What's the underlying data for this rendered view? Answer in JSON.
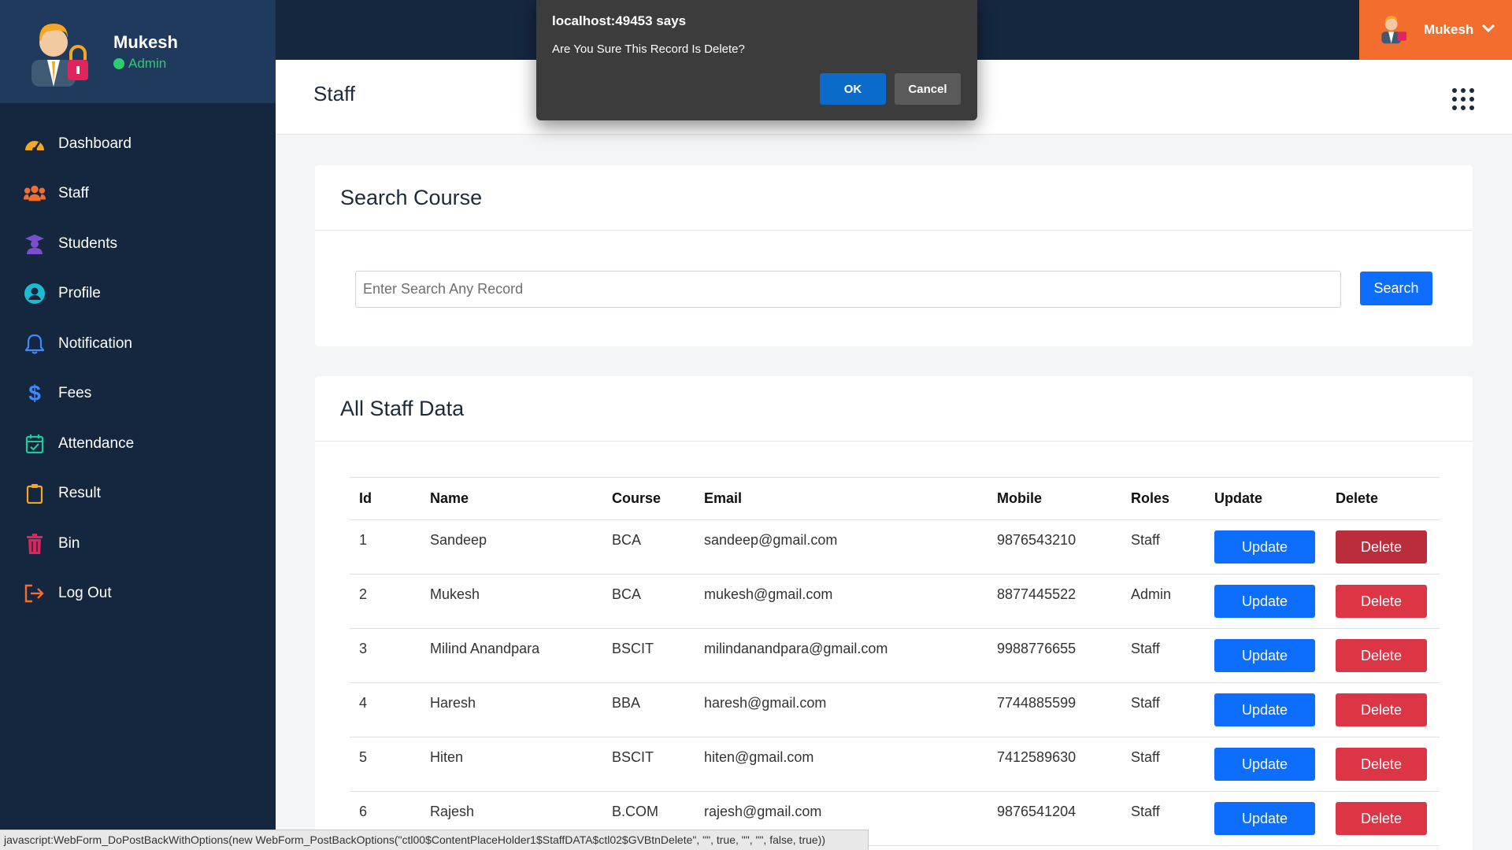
{
  "sidebar": {
    "user_name": "Mukesh",
    "user_role": "Admin",
    "items": [
      {
        "label": "Dashboard",
        "icon": "dashboard-icon",
        "color": "#f5a623"
      },
      {
        "label": "Staff",
        "icon": "users-icon",
        "color": "#f26d2e"
      },
      {
        "label": "Students",
        "icon": "graduate-icon",
        "color": "#7b4fc9"
      },
      {
        "label": "Profile",
        "icon": "user-circle-icon",
        "color": "#1abcd1"
      },
      {
        "label": "Notification",
        "icon": "bell-icon",
        "color": "#3d8bfd"
      },
      {
        "label": "Fees",
        "icon": "dollar-icon",
        "color": "#3d8bfd"
      },
      {
        "label": "Attendance",
        "icon": "calendar-check-icon",
        "color": "#20c997"
      },
      {
        "label": "Result",
        "icon": "clipboard-icon",
        "color": "#f5a623"
      },
      {
        "label": "Bin",
        "icon": "trash-icon",
        "color": "#e0245e"
      },
      {
        "label": "Log Out",
        "icon": "logout-icon",
        "color": "#f26d2e"
      }
    ]
  },
  "topbar": {
    "user_name": "Mukesh"
  },
  "page": {
    "title": "Staff"
  },
  "search": {
    "title": "Search Course",
    "placeholder": "Enter Search Any Record",
    "button": "Search"
  },
  "table": {
    "title": "All Staff Data",
    "columns": [
      "Id",
      "Name",
      "Course",
      "Email",
      "Mobile",
      "Roles",
      "Update",
      "Delete"
    ],
    "update_label": "Update",
    "delete_label": "Delete",
    "rows": [
      {
        "id": "1",
        "name": "Sandeep",
        "course": "BCA",
        "email": "sandeep@gmail.com",
        "mobile": "9876543210",
        "role": "Staff"
      },
      {
        "id": "2",
        "name": "Mukesh",
        "course": "BCA",
        "email": "mukesh@gmail.com",
        "mobile": "8877445522",
        "role": "Admin"
      },
      {
        "id": "3",
        "name": "Milind Anandpara",
        "course": "BSCIT",
        "email": "milindanandpara@gmail.com",
        "mobile": "9988776655",
        "role": "Staff"
      },
      {
        "id": "4",
        "name": "Haresh",
        "course": "BBA",
        "email": "haresh@gmail.com",
        "mobile": "7744885599",
        "role": "Staff"
      },
      {
        "id": "5",
        "name": "Hiten",
        "course": "BSCIT",
        "email": "hiten@gmail.com",
        "mobile": "7412589630",
        "role": "Staff"
      },
      {
        "id": "6",
        "name": "Rajesh",
        "course": "B.COM",
        "email": "rajesh@gmail.com",
        "mobile": "9876541204",
        "role": "Staff"
      }
    ]
  },
  "dialog": {
    "title": "localhost:49453 says",
    "message": "Are You Sure This Record Is Delete?",
    "ok": "OK",
    "cancel": "Cancel"
  },
  "statusbar": {
    "text": "javascript:WebForm_DoPostBackWithOptions(new WebForm_PostBackOptions(\"ctl00$ContentPlaceHolder1$StaffDATA$ctl02$GVBtnDelete\", \"\", true, \"\", \"\", false, true))"
  },
  "colors": {
    "sidebar": "#15263f",
    "sidebar_header": "#1f3a5c",
    "accent_orange": "#f26d2e",
    "primary": "#0d6efd",
    "danger": "#dc3545",
    "online": "#2ecc71"
  }
}
